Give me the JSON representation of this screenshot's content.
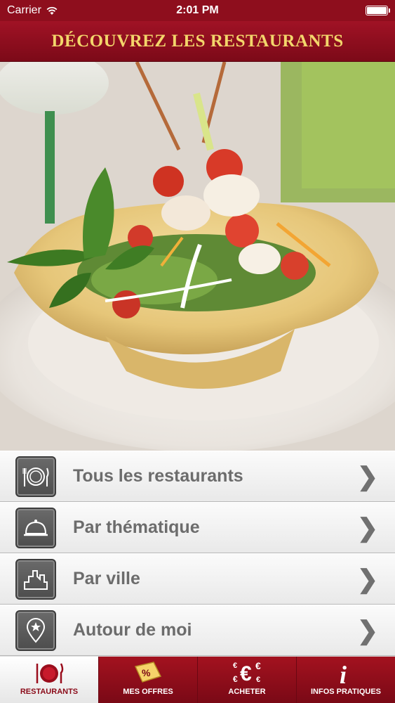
{
  "status_bar": {
    "carrier": "Carrier",
    "time": "2:01 PM"
  },
  "header": {
    "title": "DÉCOUVREZ LES RESTAURANTS"
  },
  "colors": {
    "brand_red": "#8e0e1d",
    "title_gold": "#f3d66b",
    "menu_text": "#6c6c6c"
  },
  "menu": {
    "items": [
      {
        "label": "Tous les restaurants",
        "icon": "plate-cutlery-icon"
      },
      {
        "label": "Par thématique",
        "icon": "cloche-icon"
      },
      {
        "label": "Par ville",
        "icon": "city-skyline-icon"
      },
      {
        "label": "Autour de moi",
        "icon": "location-pin-star-icon"
      }
    ],
    "chevron": "❯"
  },
  "tabbar": {
    "tabs": [
      {
        "label": "RESTAURANTS",
        "icon": "plate-cutlery-icon",
        "active": true
      },
      {
        "label": "MES OFFRES",
        "icon": "percent-tag-icon",
        "active": false
      },
      {
        "label": "ACHETER",
        "icon": "euro-coins-icon",
        "active": false
      },
      {
        "label": "INFOS PRATIQUES",
        "icon": "info-icon",
        "active": false
      }
    ]
  }
}
